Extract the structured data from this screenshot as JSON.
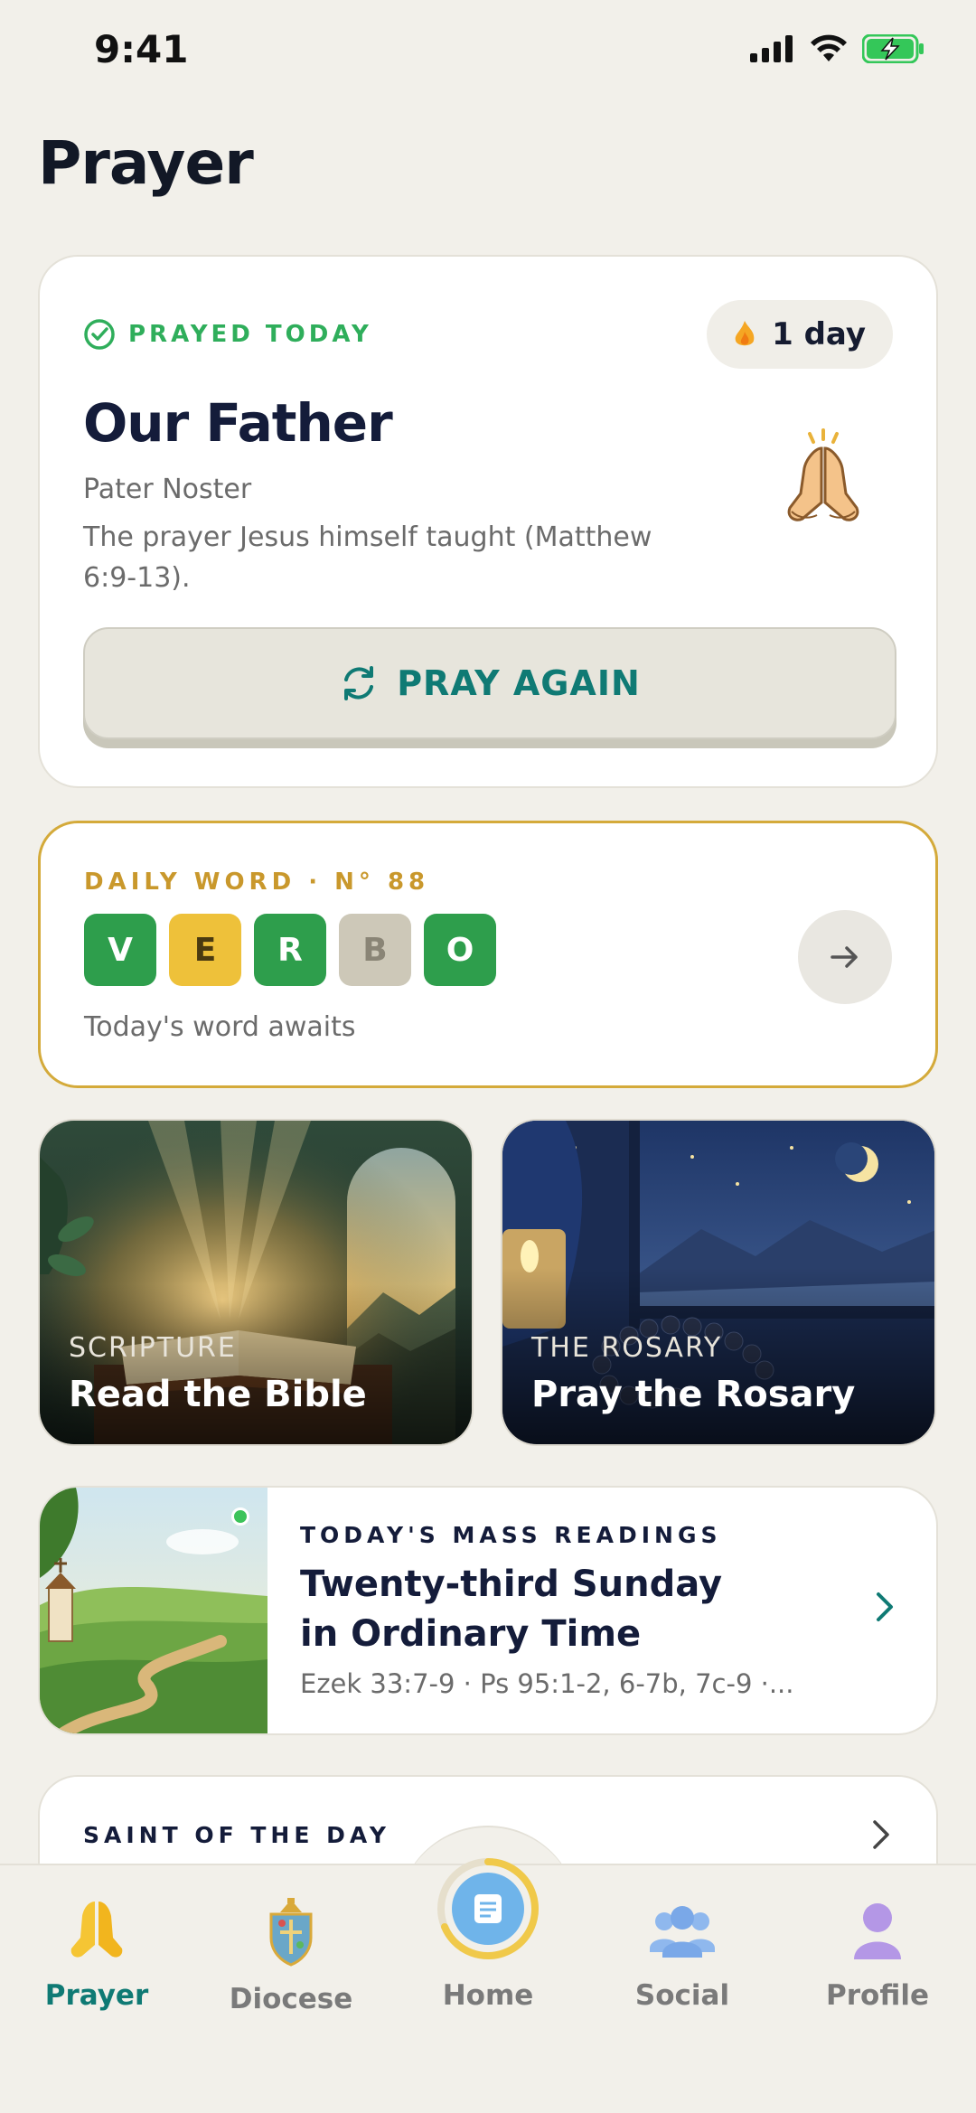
{
  "status_bar": {
    "time": "9:41"
  },
  "page": {
    "title": "Prayer"
  },
  "prayer_card": {
    "status_label": "PRAYED TODAY",
    "streak": "1 day",
    "title": "Our Father",
    "subtitle": "Pater Noster",
    "description": "The prayer Jesus himself taught (Matthew 6:9-13).",
    "button_label": "PRAY AGAIN",
    "icon": "praying-hands-emoji"
  },
  "daily_word": {
    "heading": "DAILY WORD · N° 88",
    "tiles": [
      {
        "letter": "V",
        "state": "correct"
      },
      {
        "letter": "E",
        "state": "present"
      },
      {
        "letter": "R",
        "state": "correct"
      },
      {
        "letter": "B",
        "state": "absent"
      },
      {
        "letter": "O",
        "state": "correct"
      }
    ],
    "subtitle": "Today's word awaits"
  },
  "feature_cards": [
    {
      "kicker": "SCRIPTURE",
      "title": "Read the Bible"
    },
    {
      "kicker": "THE ROSARY",
      "title": "Pray the Rosary"
    }
  ],
  "mass_readings": {
    "kicker": "TODAY'S MASS READINGS",
    "title": "Twenty-third Sunday in Ordinary Time",
    "refs": "Ezek 33:7-9  ·  Ps 95:1-2, 6-7b, 7c-9  ·..."
  },
  "saint": {
    "label": "SAINT OF THE DAY"
  },
  "tabs": [
    {
      "label": "Prayer",
      "active": true
    },
    {
      "label": "Diocese",
      "active": false
    },
    {
      "label": "Home",
      "active": false
    },
    {
      "label": "Social",
      "active": false
    },
    {
      "label": "Profile",
      "active": false
    }
  ],
  "colors": {
    "accent_teal": "#0f7a74",
    "success_green": "#2fae5b",
    "gold": "#c9982c",
    "background": "#f2f0ea"
  }
}
